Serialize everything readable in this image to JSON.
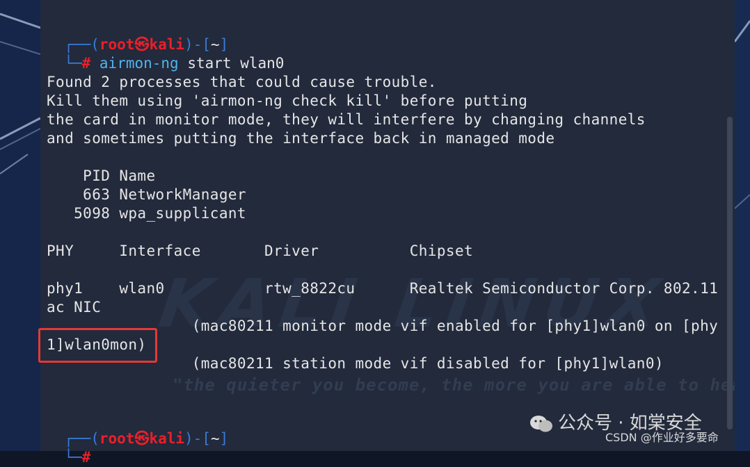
{
  "prompt": {
    "user": "root",
    "host": "kali",
    "skull": "㉿",
    "cwd": "~",
    "hash": "#",
    "top_prefix": "┌──(",
    "bottom_prefix": "└─",
    "mid": ")-[",
    "end": "]"
  },
  "command": {
    "program": "airmon-ng",
    "args": " start wlan0"
  },
  "output": {
    "warning": [
      "Found 2 processes that could cause trouble.",
      "Kill them using 'airmon-ng check kill' before putting",
      "the card in monitor mode, they will interfere by changing channels",
      "and sometimes putting the interface back in managed mode"
    ],
    "proc_header": "    PID Name",
    "processes": [
      "    663 NetworkManager",
      "   5098 wpa_supplicant"
    ],
    "table_header": "PHY     Interface       Driver          Chipset",
    "table_row": "phy1    wlan0           rtw_8822cu      Realtek Semiconductor Corp. 802.11",
    "table_row_wrap": "ac NIC",
    "monitor_line": "                (mac80211 monitor mode vif enabled for [phy1]wlan0 on [phy",
    "monitor_wrap": "1]wlan0mon)",
    "station_line": "                (mac80211 station mode vif disabled for [phy1]wlan0)"
  },
  "wallpaper": {
    "logo": "KALI LINUX",
    "quote": "\"the quieter you become, the more you are able to hear\""
  },
  "watermarks": {
    "wechat": "公众号 · 如棠安全",
    "csdn": "CSDN @作业好多要命"
  },
  "colors": {
    "terminal_bg": "#222a3c",
    "prompt_blue": "#3a7bd5",
    "prompt_red": "#e8202a",
    "command_cyan": "#53b3ec",
    "highlight": "#e53935"
  }
}
